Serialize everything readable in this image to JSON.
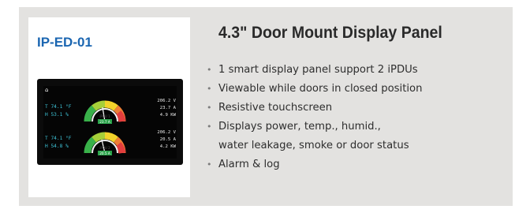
{
  "product": {
    "model": "IP-ED-01",
    "title": "4.3\" Door Mount Display Panel",
    "features": [
      "1 smart display panel support 2 iPDUs",
      "Viewable while doors in closed position",
      "Resistive touchscreen",
      "Displays power, temp., humid.,",
      "water leakage, smoke or door status",
      "Alarm & log"
    ]
  },
  "display": {
    "home_icon": "home-icon",
    "rows": [
      {
        "temp": "T 74.1 °F",
        "humid": "H 53.1 %",
        "pdu_label": "iPDU 1",
        "current": "23.7 A",
        "volts": "206.2 V",
        "amps": "23.7 A",
        "power": "4.9 KW",
        "gauge_level": 0.47
      },
      {
        "temp": "T 74.1 °F",
        "humid": "H 54.8 %",
        "pdu_label": "iPDU 2",
        "current": "20.5 A",
        "volts": "206.2 V",
        "amps": "20.5 A",
        "power": "4.2 KW",
        "gauge_level": 0.41
      }
    ]
  },
  "colors": {
    "model_blue": "#1b66b1",
    "panel_bg": "#e3e2e0",
    "env_text": "#3ec3d6",
    "gauge_value_bg": "#2aa34a"
  }
}
